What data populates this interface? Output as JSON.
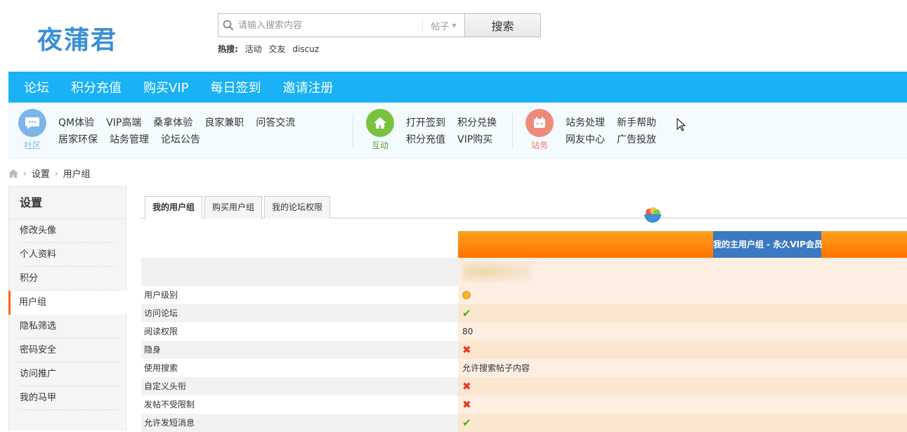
{
  "logo": "夜蒲君",
  "search": {
    "placeholder": "请输入搜索内容",
    "type": "帖子",
    "button": "搜索"
  },
  "hot": {
    "label": "热搜:",
    "items": [
      "活动",
      "交友",
      "discuz"
    ]
  },
  "nav": [
    "论坛",
    "积分充值",
    "购买VIP",
    "每日签到",
    "邀请注册"
  ],
  "subnav": {
    "community": {
      "label": "社区",
      "row1": [
        "QM体验",
        "VIP高端",
        "桑拿体验",
        "良家兼职",
        "问答交流"
      ],
      "row2": [
        "居家环保",
        "站务管理",
        "论坛公告"
      ]
    },
    "interact": {
      "label": "互动",
      "row1": [
        "打开签到",
        "积分兑换"
      ],
      "row2": [
        "积分充值",
        "VIP购买"
      ]
    },
    "affairs": {
      "label": "站务",
      "row1": [
        "站务处理",
        "新手帮助"
      ],
      "row2": [
        "网友中心",
        "广告投放"
      ]
    }
  },
  "breadcrumb": [
    "设置",
    "用户组"
  ],
  "sidebar": {
    "title": "设置",
    "items": [
      "修改头像",
      "个人资料",
      "积分",
      "用户组",
      "隐私筛选",
      "密码安全",
      "访问推广",
      "我的马甲"
    ],
    "active_index": 3
  },
  "tabs": [
    "我的用户组",
    "购买用户组",
    "我的论坛权限"
  ],
  "group_header": "我的主用户组 - 永久VIP会员",
  "rows": [
    {
      "key": "用户级别",
      "type": "icon",
      "icon": "smile-icon"
    },
    {
      "key": "访问论坛",
      "type": "check"
    },
    {
      "key": "阅读权限",
      "type": "text",
      "value": "80"
    },
    {
      "key": "隐身",
      "type": "cross"
    },
    {
      "key": "使用搜索",
      "type": "text",
      "value": "允许搜索帖子内容"
    },
    {
      "key": "自定义头衔",
      "type": "cross"
    },
    {
      "key": "发帖不受限制",
      "type": "cross"
    },
    {
      "key": "允许发短消息",
      "type": "check"
    }
  ],
  "symbols": {
    "check": "✔",
    "cross": "✖"
  },
  "colors": {
    "nav": "#1ab1f5",
    "accent": "#ff7300",
    "vip": "#3b79c2"
  }
}
